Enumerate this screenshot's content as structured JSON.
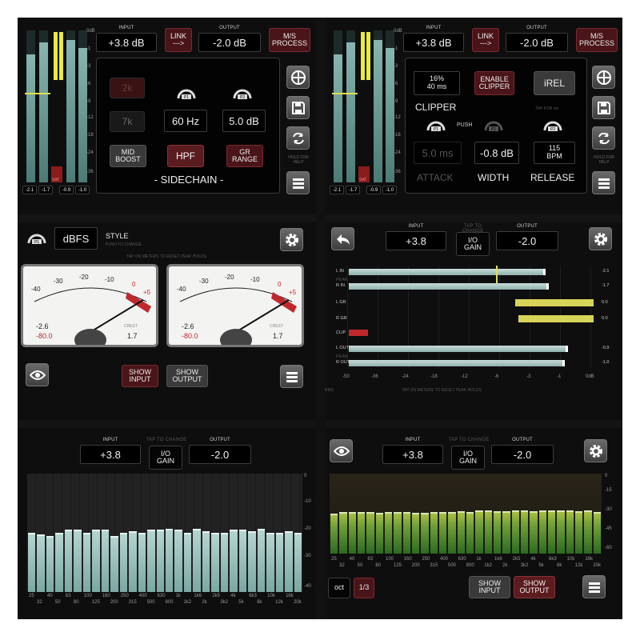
{
  "tl": {
    "meter_scale": [
      "0dB",
      "-1",
      "-3",
      "-6",
      "-9",
      "-12",
      "-18",
      "-24",
      "-36"
    ],
    "meter_levels": [
      0.84,
      0.92,
      0.1,
      0.92,
      0.86
    ],
    "readouts": [
      "-2.1",
      "-1.7",
      "-0.9",
      "-1.0"
    ],
    "sat": "SAT",
    "input_label": "INPUT",
    "input_value": "+3.8 dB",
    "link": "LINK",
    "link_arrow": "--->",
    "output_label": "OUTPUT",
    "output_value": "-2.0 dB",
    "ms_line1": "M/S",
    "ms_line2": "PROCESS",
    "freq_2k": "2k",
    "freq_7k": "7k",
    "p1": "P1",
    "p2": "P2",
    "hz": "60 Hz",
    "db": "5.0 dB",
    "mid1": "MID",
    "mid2": "BOOST",
    "hpf": "HPF",
    "gr1": "GR",
    "gr2": "RANGE",
    "sidechain": "- SIDECHAIN -",
    "hold1": "HOLD FOR",
    "hold2": "HELP"
  },
  "tr": {
    "meter_scale": [
      "0dB",
      "-1",
      "-3",
      "-6",
      "-9",
      "-12",
      "-18",
      "-24",
      "-36"
    ],
    "readouts": [
      "-2.1",
      "-1.7",
      "-0.9",
      "-1.0"
    ],
    "sat": "SAT",
    "input_label": "INPUT",
    "input_value": "+3.8 dB",
    "link": "LINK",
    "link_arrow": "--->",
    "output_label": "OUTPUT",
    "output_value": "-2.0 dB",
    "ms_line1": "M/S",
    "ms_line2": "PROCESS",
    "pct": "16%",
    "ms": "40 ms",
    "en1": "ENABLE",
    "en2": "CLIPPER",
    "irel": "iREL",
    "clipper": "CLIPPER",
    "tap": "TAP FOR ms",
    "push": "PUSH",
    "p1": "P1",
    "p2": "P2",
    "attack_val": "5.0 ms",
    "width_val": "-0.8 dB",
    "bpm1": "115",
    "bpm2": "BPM",
    "attack": "ATTACK",
    "width": "WIDTH",
    "release": "RELEASE",
    "hold1": "HOLD FOR",
    "hold2": "HELP"
  },
  "ml": {
    "p1": "P1",
    "mode": "dBFS",
    "style": "STYLE",
    "push": "PUSH TO CHANGE",
    "tap": "TAP ON METERS TO RESET PEAK HOLDS",
    "scale": [
      "-40",
      "-30",
      "-20",
      "-10",
      "0",
      "+5"
    ],
    "left": {
      "peak": "-2.6",
      "rms": "-80.0",
      "crest_label": "CREST",
      "crest": "1.7"
    },
    "right": {
      "peak": "-2.6",
      "rms": "-80.0",
      "crest_label": "CREST",
      "crest": "1.7"
    },
    "show_input": [
      "SHOW",
      "INPUT"
    ],
    "show_output": [
      "SHOW",
      "OUTPUT"
    ]
  },
  "mr": {
    "input_label": "INPUT",
    "input_value": "+3.8",
    "tap": "TAP TO CHANGE",
    "io1": "I/O",
    "io2": "GAIN",
    "output_label": "OUTPUT",
    "output_value": "-2.0",
    "rows": [
      {
        "label": "L IN",
        "sub": "",
        "value": "-2.1"
      },
      {
        "label": "R IN",
        "sub": "PEAK",
        "value": "-1.7"
      },
      {
        "label": "L GR",
        "sub": "",
        "value": "0.0"
      },
      {
        "label": "R GR",
        "sub": "",
        "value": "0.0"
      },
      {
        "label": "CLIP",
        "sub": "",
        "value": ""
      },
      {
        "label": "L OUT",
        "sub": "",
        "value": "-0.9"
      },
      {
        "label": "R OUT",
        "sub": "PEAK",
        "value": "-1.0"
      }
    ],
    "scale": [
      "-50",
      "-36",
      "-24",
      "-18",
      "-12",
      "-6",
      "-3",
      "-1",
      "0dB"
    ],
    "rms": "RMS",
    "tap_reset": "TAP ON METERS TO RESET PEAK HOLDS"
  },
  "bl": {
    "input_label": "INPUT",
    "input_value": "+3.8",
    "tap": "TAP TO CHANGE",
    "io1": "I/O",
    "io2": "GAIN",
    "output_label": "OUTPUT",
    "output_value": "-2.0",
    "yaxis": [
      "0",
      "-10",
      "-20",
      "-30",
      "-40"
    ],
    "freq_top": [
      "25",
      "40",
      "63",
      "100",
      "160",
      "250",
      "400",
      "630",
      "1k",
      "1k6",
      "2k5",
      "4k",
      "6k3",
      "10k",
      "16k"
    ],
    "freq_bot": [
      "32",
      "50",
      "80",
      "125",
      "200",
      "315",
      "500",
      "800",
      "1k2",
      "2k",
      "3k2",
      "5k",
      "8k",
      "12k",
      "20k"
    ],
    "band_levels": [
      -21,
      -21.5,
      -22,
      -21,
      -20,
      -20,
      -21,
      -20,
      -20,
      -22,
      -21,
      -20.5,
      -21,
      -20,
      -20,
      -19.5,
      -20,
      -21,
      -19.5,
      -20.5,
      -21,
      -21,
      -20,
      -20,
      -20.5,
      -19.5,
      -21,
      -21,
      -20.5,
      -21
    ]
  },
  "br": {
    "input_label": "INPUT",
    "input_value": "+3.8",
    "tap": "TAP TO CHANGE",
    "io1": "I/O",
    "io2": "GAIN",
    "output_label": "OUTPUT",
    "output_value": "-2.0",
    "yaxis": [
      "0",
      "-15",
      "-30",
      "-45",
      "-60"
    ],
    "freq_top": [
      "25",
      "40",
      "63",
      "100",
      "160",
      "250",
      "400",
      "630",
      "1k",
      "1k6",
      "2k5",
      "4k",
      "6k3",
      "10k",
      "16k"
    ],
    "freq_bot": [
      "32",
      "50",
      "80",
      "125",
      "200",
      "315",
      "500",
      "800",
      "1k2",
      "2k",
      "3k2",
      "5k",
      "8k",
      "12k",
      "20k"
    ],
    "band_levels": [
      -31,
      -30,
      -30,
      -29.5,
      -30,
      -30.5,
      -30,
      -29.5,
      -29.5,
      -30.5,
      -30.5,
      -30,
      -29.5,
      -29.5,
      -29,
      -29.5,
      -28.5,
      -28.5,
      -29,
      -29,
      -28.5,
      -28.5,
      -29,
      -28.5,
      -28.5,
      -28.5,
      -28.5,
      -29,
      -28.5,
      -29.5
    ],
    "oct": "oct",
    "third": "1/3",
    "show_input": [
      "SHOW",
      "INPUT"
    ],
    "show_output": [
      "SHOW",
      "OUTPUT"
    ]
  },
  "colors": {
    "accent_red": "#c0282e",
    "meter_teal": "#88b5b0",
    "gr_yellow": "#d8d45a",
    "spectrum_green": "#70a038"
  }
}
